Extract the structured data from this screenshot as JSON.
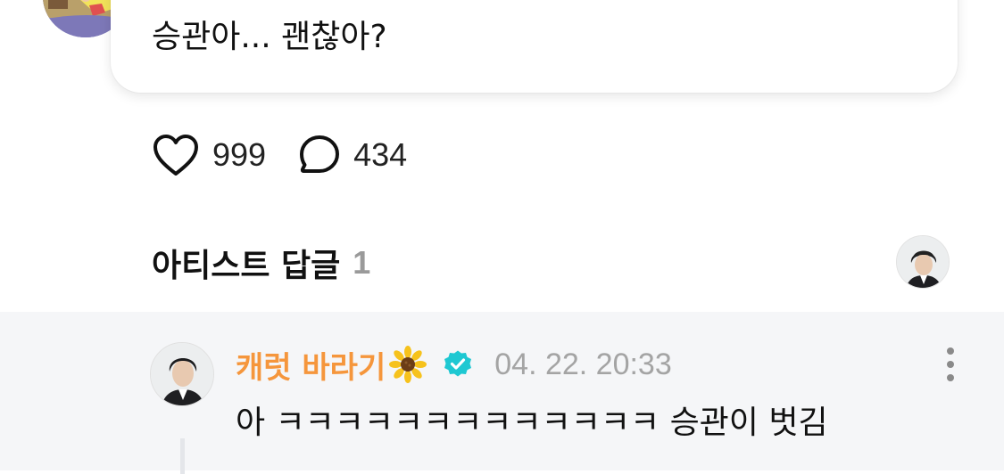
{
  "post": {
    "text": "승관아... 괜찮아?"
  },
  "reactions": {
    "likes": "999",
    "comments": "434"
  },
  "artist_replies": {
    "label": "아티스트 답글",
    "count": "1"
  },
  "reply": {
    "author": "캐럿 바라기",
    "author_emoji": "sunflower-icon",
    "verified": true,
    "timestamp": "04. 22. 20:33",
    "text": "아 ㅋㅋㅋㅋㅋㅋㅋㅋㅋㅋㅋㅋㅋ 승관이 벗김"
  },
  "colors": {
    "artist_name": "#f5963c",
    "verified_badge": "#1ec8d2",
    "muted_text": "#a4a4a4",
    "reply_background": "#f5f6f8"
  }
}
